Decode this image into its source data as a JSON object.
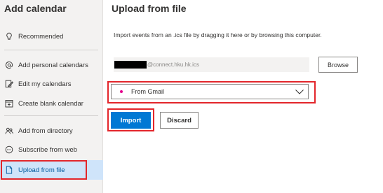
{
  "sidebar": {
    "title": "Add calendar",
    "items": [
      {
        "label": "Recommended",
        "icon": "lightbulb-icon"
      },
      {
        "label": "Add personal calendars",
        "icon": "at-sign-icon"
      },
      {
        "label": "Edit my calendars",
        "icon": "edit-icon"
      },
      {
        "label": "Create blank calendar",
        "icon": "calendar-add-icon"
      },
      {
        "label": "Add from directory",
        "icon": "people-icon"
      },
      {
        "label": "Subscribe from web",
        "icon": "web-icon"
      },
      {
        "label": "Upload from file",
        "icon": "document-icon",
        "selected": true
      }
    ]
  },
  "main": {
    "title": "Upload from file",
    "instructions": "Import events from an .ics file by dragging it here or by browsing this computer.",
    "file_input": {
      "value_suffix": "@connect.hku.hk.ics"
    },
    "browse_label": "Browse",
    "calendar_select": {
      "selected": "From Gmail",
      "dot_color": "#e3008c"
    },
    "import_label": "Import",
    "discard_label": "Discard"
  },
  "colors": {
    "accent": "#0078d4",
    "annotation": "#e3262b",
    "sidebar_bg": "#f3f2f1",
    "selected_bg": "#cfe4fa"
  }
}
